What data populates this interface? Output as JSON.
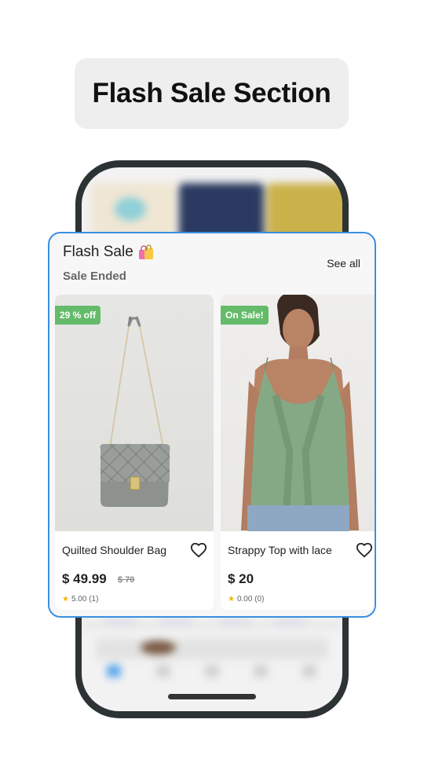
{
  "header": {
    "title": "Flash Sale Section"
  },
  "flash_sale": {
    "title": "Flash Sale",
    "bag_icon": "shopping-bags-icon",
    "status": "Sale Ended",
    "see_all": "See all",
    "products": [
      {
        "badge": "29 % off",
        "name": "Quilted Shoulder Bag",
        "price": "$ 49.99",
        "old_price": "$ 70",
        "rating": "5.00 (1)",
        "image": "quilted-bag-image",
        "favorite_icon": "heart-outline-icon"
      },
      {
        "badge": "On Sale!",
        "name": "Strappy Top with lace",
        "price": "$ 20",
        "old_price": "",
        "rating": "0.00 (0)",
        "image": "model-green-top-image",
        "favorite_icon": "heart-outline-icon"
      }
    ]
  },
  "colors": {
    "accent_border": "#3a8fe0",
    "badge_green": "#64bb6a",
    "star": "#f4b400",
    "phone_frame": "#2d3235"
  }
}
